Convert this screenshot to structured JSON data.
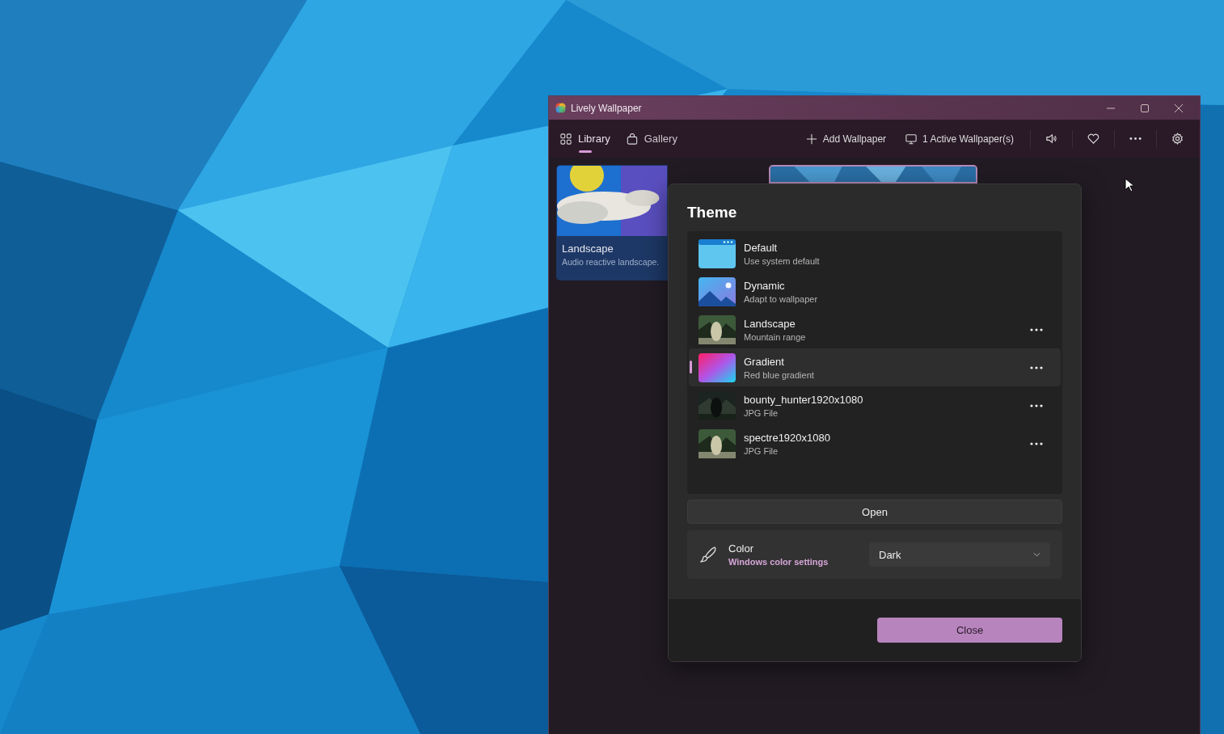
{
  "window": {
    "title": "Lively Wallpaper"
  },
  "tabs": [
    {
      "label": "Library",
      "selected": true
    },
    {
      "label": "Gallery",
      "selected": false
    }
  ],
  "toolbar": [
    {
      "kind": "text",
      "label": "Add Wallpaper"
    },
    {
      "kind": "text",
      "label": "1 Active Wallpaper(s)"
    },
    {
      "kind": "icon"
    },
    {
      "kind": "icon"
    },
    {
      "kind": "icon"
    },
    {
      "kind": "icon"
    }
  ],
  "library": [
    {
      "title": "Landscape",
      "description": "Audio reactive landscape.",
      "selected": false
    },
    {
      "selected": true
    }
  ],
  "dialog": {
    "title": "Theme",
    "themes": [
      {
        "name": "Default",
        "description": "Use system default",
        "kind": "window",
        "has_menu": false,
        "selected": false
      },
      {
        "name": "Dynamic",
        "description": "Adapt to wallpaper",
        "kind": "mountains",
        "has_menu": false,
        "selected": false
      },
      {
        "name": "Landscape",
        "description": "Mountain range",
        "kind": "picture",
        "has_menu": true,
        "selected": false
      },
      {
        "name": "Gradient",
        "description": "Red blue gradient",
        "kind": "gradient",
        "has_menu": true,
        "selected": true
      },
      {
        "name": "bounty_hunter1920x1080",
        "description": "JPG File",
        "kind": "picture",
        "has_menu": true,
        "selected": false
      },
      {
        "name": "spectre1920x1080",
        "description": "JPG File",
        "kind": "picture",
        "has_menu": true,
        "selected": false
      }
    ],
    "open_button": "Open",
    "color": {
      "label": "Color",
      "link": "Windows color settings",
      "value": "Dark"
    },
    "close_button": "Close"
  }
}
